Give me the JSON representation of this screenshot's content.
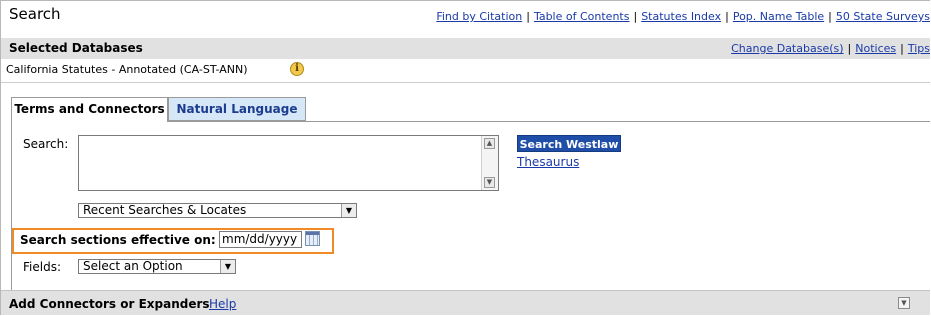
{
  "header": {
    "title": "Search",
    "links": [
      "Find by Citation",
      "Table of Contents",
      "Statutes Index",
      "Pop. Name Table",
      "50 State Surveys"
    ]
  },
  "databases": {
    "label": "Selected Databases",
    "links": [
      "Change Database(s)",
      "Notices",
      "Tips"
    ],
    "name": "California Statutes - Annotated (CA-ST-ANN)"
  },
  "tabs": [
    {
      "label": "Terms and Connectors",
      "active": true
    },
    {
      "label": "Natural Language",
      "active": false
    }
  ],
  "form": {
    "search_label": "Search:",
    "search_value": "",
    "search_button": "Search Westlaw",
    "thesaurus_link": "Thesaurus",
    "recent_select": "Recent Searches & Locates",
    "effective_label": "Search sections effective on:",
    "date_placeholder": "mm/dd/yyyy",
    "fields_label": "Fields:",
    "fields_select": "Select an Option"
  },
  "add_bar": {
    "label": "Add Connectors or Expanders",
    "help": "Help"
  },
  "colors": {
    "link": "#1a3aa8",
    "highlight": "#f08a24",
    "button": "#1f4ea8",
    "bar": "#e1e1e1"
  }
}
